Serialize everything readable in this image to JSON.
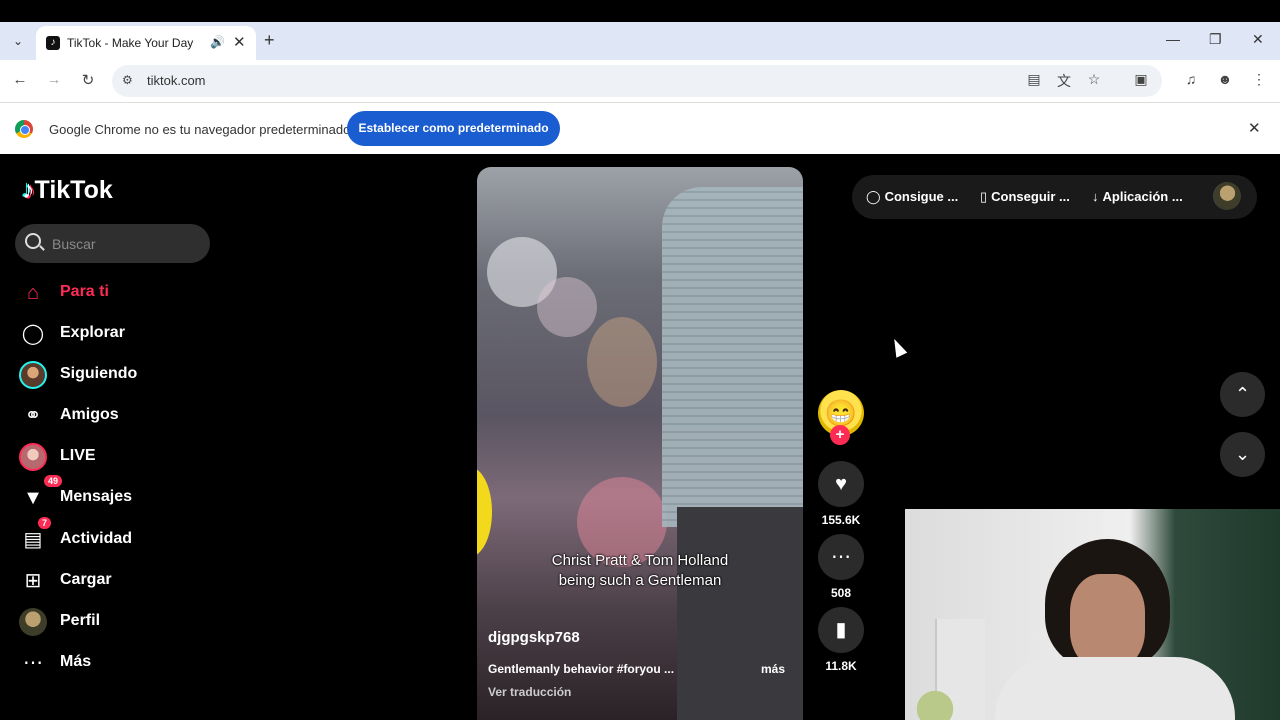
{
  "browser": {
    "tab_title": "TikTok - Make Your Day",
    "url": "tiktok.com",
    "infobar_text": "Google Chrome no es tu navegador predeterminado",
    "infobar_button": "Establecer como predeterminado"
  },
  "sidebar": {
    "logo": "TikTok",
    "search_placeholder": "Buscar",
    "items": [
      {
        "label": "Para ti",
        "icon": "home-icon",
        "active": true
      },
      {
        "label": "Explorar",
        "icon": "compass-icon"
      },
      {
        "label": "Siguiendo",
        "icon": "following-avatar-icon"
      },
      {
        "label": "Amigos",
        "icon": "friends-icon"
      },
      {
        "label": "LIVE",
        "icon": "live-avatar-icon"
      },
      {
        "label": "Mensajes",
        "icon": "messages-icon",
        "badge": "49"
      },
      {
        "label": "Actividad",
        "icon": "activity-icon",
        "badge": "7"
      },
      {
        "label": "Cargar",
        "icon": "upload-icon"
      },
      {
        "label": "Perfil",
        "icon": "profile-avatar-icon"
      },
      {
        "label": "Más",
        "icon": "more-icon"
      }
    ]
  },
  "video": {
    "caption_line1": "Christ Pratt & Tom Holland",
    "caption_line2": "being such a Gentleman",
    "author": "djgpgskp768",
    "description": "Gentlemanly behavior #foryou ...",
    "more": "más",
    "translate": "Ver traducción",
    "likes": "155.6K",
    "comments": "508",
    "saves": "11.8K"
  },
  "top_actions": {
    "coins": "Consigue ...",
    "get_app": "Conseguir ...",
    "download": "Aplicación ..."
  },
  "colors": {
    "accent": "#fe2c55",
    "cyan": "#25f4ee",
    "chrome_button": "#1a5dd0"
  }
}
